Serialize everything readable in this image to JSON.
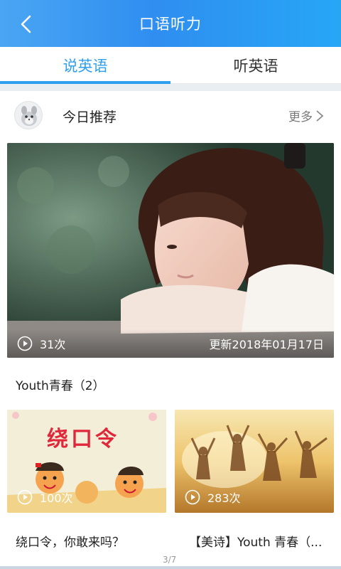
{
  "header": {
    "title": "口语听力",
    "back_icon": "chevron-left-icon"
  },
  "tabs": [
    {
      "label": "说英语",
      "active": true
    },
    {
      "label": "听英语",
      "active": false
    }
  ],
  "section": {
    "title": "今日推荐",
    "more_label": "更多"
  },
  "hero": {
    "plays": "31次",
    "updated": "更新2018年01月17日"
  },
  "album": {
    "title": "Youth青春（2）"
  },
  "items": [
    {
      "image_text": "绕口令",
      "plays": "100次",
      "caption": "绕口令，你敢来吗？"
    },
    {
      "plays": "283次",
      "caption": "【美诗】Youth 青春（..."
    }
  ],
  "pager": {
    "label": "3/7"
  },
  "colors": {
    "accent": "#2fa0ef",
    "header_start": "#4aa6f3",
    "header_end": "#27a6f6"
  }
}
